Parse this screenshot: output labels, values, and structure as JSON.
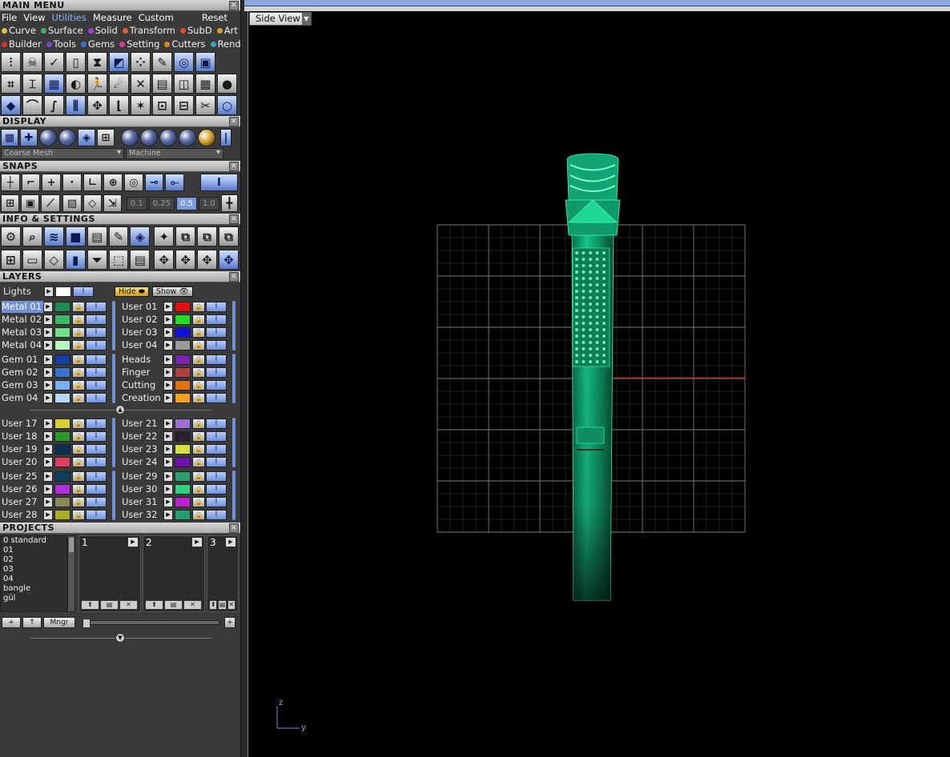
{
  "main_menu": {
    "title": "MAIN MENU",
    "menu": [
      "File",
      "View",
      "Utilities",
      "Measure",
      "Custom"
    ],
    "reset": "Reset",
    "categories_row1": [
      {
        "label": "Curve",
        "color": "#e0c040"
      },
      {
        "label": "Surface",
        "color": "#40b070"
      },
      {
        "label": "Solid",
        "color": "#a040d0"
      },
      {
        "label": "Transform",
        "color": "#e06030"
      },
      {
        "label": "SubD",
        "color": "#e05020"
      },
      {
        "label": "Art",
        "color": "#d0a030"
      }
    ],
    "categories_row2": [
      {
        "label": "Builder",
        "color": "#e03030"
      },
      {
        "label": "Tools",
        "color": "#8040d0"
      },
      {
        "label": "Gems",
        "color": "#4070d0"
      },
      {
        "label": "Setting",
        "color": "#d04090"
      },
      {
        "label": "Cutters",
        "color": "#e08020"
      },
      {
        "label": "Render",
        "color": "#40a0d0"
      }
    ]
  },
  "display": {
    "title": "DISPLAY",
    "mesh_select": "Coarse Mesh",
    "render_select": "Machine"
  },
  "snaps": {
    "title": "SNAPS",
    "values": [
      "0.1",
      "0.25",
      "0.5",
      "1.0"
    ],
    "selected_value": "0.5"
  },
  "info": {
    "title": "INFO & SETTINGS"
  },
  "layers": {
    "title": "LAYERS",
    "lights_label": "Lights",
    "hide_label": "Hide",
    "show_label": "Show",
    "groups": [
      {
        "left": [
          {
            "name": "Metal 01",
            "color": "#1f8a52",
            "selected": true
          },
          {
            "name": "Metal 02",
            "color": "#3cb868"
          },
          {
            "name": "Metal 03",
            "color": "#6fe08a"
          },
          {
            "name": "Metal 04",
            "color": "#b8f5c0"
          }
        ],
        "right": [
          {
            "name": "User 01",
            "color": "#e01010"
          },
          {
            "name": "User 02",
            "color": "#20e020"
          },
          {
            "name": "User 03",
            "color": "#1010e0"
          },
          {
            "name": "User 04",
            "color": "#9a9a9a"
          }
        ]
      },
      {
        "left": [
          {
            "name": "Gem 01",
            "color": "#1440a0"
          },
          {
            "name": "Gem 02",
            "color": "#3a70d0"
          },
          {
            "name": "Gem 03",
            "color": "#7ab0f0"
          },
          {
            "name": "Gem 04",
            "color": "#b8d8fa"
          }
        ],
        "right": [
          {
            "name": "Heads",
            "color": "#7a22b0"
          },
          {
            "name": "Finger",
            "color": "#b04040"
          },
          {
            "name": "Cutting",
            "color": "#e07010"
          },
          {
            "name": "Creation",
            "color": "#f0a020"
          }
        ]
      },
      {
        "left": [
          {
            "name": "User 17",
            "color": "#d8d030"
          },
          {
            "name": "User 18",
            "color": "#2a9a30"
          },
          {
            "name": "User 19",
            "color": "#0a3050"
          },
          {
            "name": "User 20",
            "color": "#e04060"
          }
        ],
        "right": [
          {
            "name": "User 21",
            "color": "#9a70d0"
          },
          {
            "name": "User 22",
            "color": "#2a2030"
          },
          {
            "name": "User 23",
            "color": "#d8e040"
          },
          {
            "name": "User 24",
            "color": "#7010b0"
          }
        ]
      },
      {
        "left": [
          {
            "name": "User 25",
            "color": "#0a4060"
          },
          {
            "name": "User 26",
            "color": "#b030e0"
          },
          {
            "name": "User 27",
            "color": "#8a8a58"
          },
          {
            "name": "User 28",
            "color": "#a8b020"
          }
        ],
        "right": [
          {
            "name": "User 29",
            "color": "#2aa070"
          },
          {
            "name": "User 30",
            "color": "#30d080"
          },
          {
            "name": "User 31",
            "color": "#c020d0"
          },
          {
            "name": "User 32",
            "color": "#20a070"
          }
        ]
      }
    ]
  },
  "projects": {
    "title": "PROJECTS",
    "list": [
      "0 standard",
      "01",
      "02",
      "03",
      "04",
      "bangle",
      "gül"
    ],
    "slots": [
      "1",
      "2",
      "3"
    ],
    "manager_label": "Mngr"
  },
  "viewport": {
    "view_name": "Side View",
    "axis_z": "z",
    "axis_y": "y",
    "model_color": "#13b07c",
    "grid_color": "#8a8a8a",
    "axis_line_color": "#b01010"
  }
}
